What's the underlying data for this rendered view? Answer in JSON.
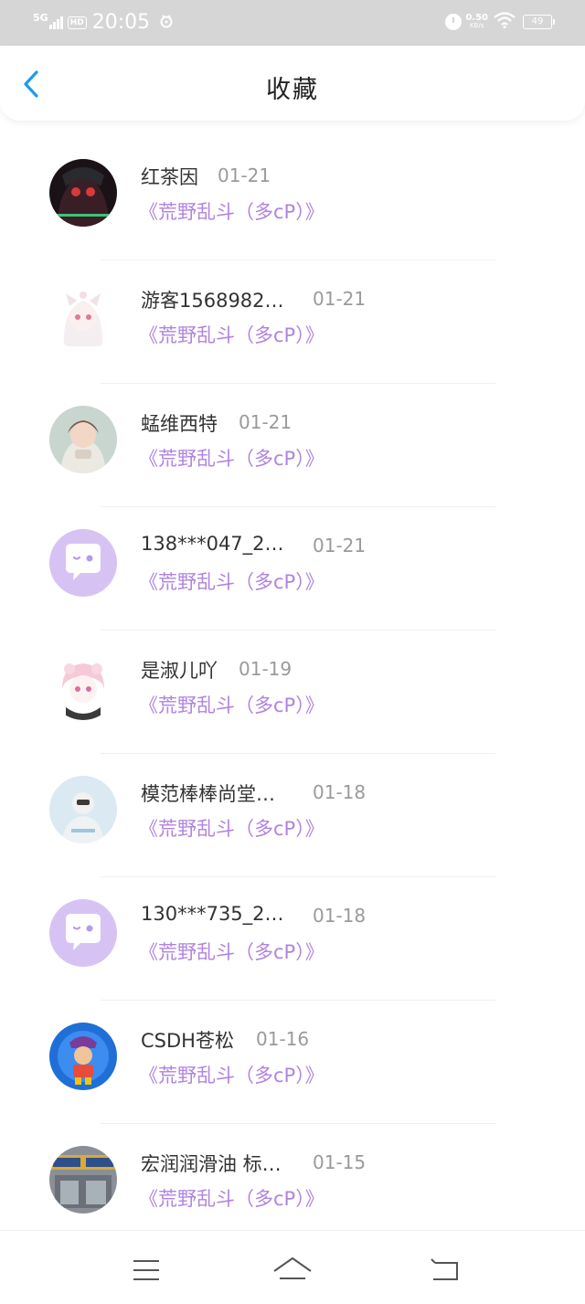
{
  "status_bar": {
    "network": "5G",
    "hd": "HD",
    "time": "20:05",
    "speed_value": "0.50",
    "speed_unit": "KB/s",
    "battery": "49",
    "icons": [
      "signal-icon",
      "notification-app-icon",
      "alarm-icon",
      "wifi-icon",
      "battery-icon"
    ]
  },
  "header": {
    "title": "收藏",
    "back_icon": "chevron-left-icon",
    "accent_color": "#1e9bea"
  },
  "colors": {
    "book_title": "#b084e0",
    "date": "#9a9a9a",
    "name": "#333333",
    "status_bar_bg": "#d6d6d6"
  },
  "items": [
    {
      "name": "红茶因",
      "date": "01-21",
      "book": "《荒野乱斗（多cP）》",
      "avatar": "photo-avatar"
    },
    {
      "name": "游客1568982…",
      "date": "01-21",
      "book": "《荒野乱斗（多cP）》",
      "avatar": "photo-avatar"
    },
    {
      "name": "蜢维西特",
      "date": "01-21",
      "book": "《荒野乱斗（多cP）》",
      "avatar": "photo-avatar"
    },
    {
      "name": "138***047_2…",
      "date": "01-21",
      "book": "《荒野乱斗（多cP）》",
      "avatar": "default-chat-avatar"
    },
    {
      "name": "是淑儿吖",
      "date": "01-19",
      "book": "《荒野乱斗（多cP）》",
      "avatar": "photo-avatar"
    },
    {
      "name": "模范棒棒尚堂…",
      "date": "01-18",
      "book": "《荒野乱斗（多cP）》",
      "avatar": "photo-avatar"
    },
    {
      "name": "130***735_2…",
      "date": "01-18",
      "book": "《荒野乱斗（多cP）》",
      "avatar": "default-chat-avatar"
    },
    {
      "name": "CSDH苍松",
      "date": "01-16",
      "book": "《荒野乱斗（多cP）》",
      "avatar": "photo-avatar"
    },
    {
      "name": "宏润润滑油 标…",
      "date": "01-15",
      "book": "《荒野乱斗（多cP）》",
      "avatar": "photo-avatar"
    }
  ],
  "bottom_nav": {
    "icons": [
      "menu-icon",
      "home-icon",
      "back-nav-icon"
    ]
  }
}
